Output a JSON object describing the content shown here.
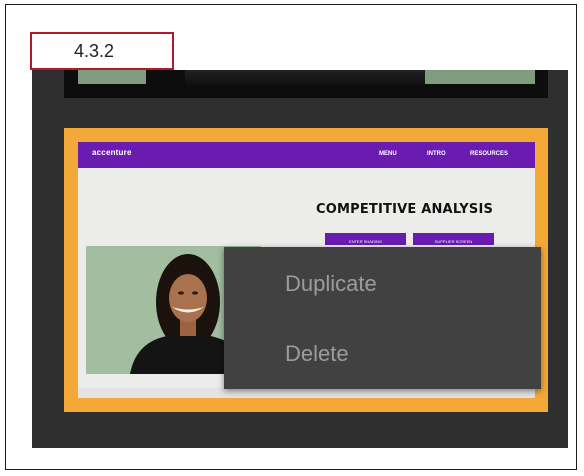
{
  "step_label": "4.3.2",
  "slide": {
    "logo_text": "accenture",
    "nav": [
      "MENU",
      "INTRO",
      "RESOURCES"
    ],
    "title": "COMPETITIVE ANALYSIS",
    "buttons": [
      "ENTER SHADING",
      "SUPPLIER SCREEN"
    ]
  },
  "context_menu": {
    "items": [
      "Duplicate",
      "Delete"
    ]
  }
}
